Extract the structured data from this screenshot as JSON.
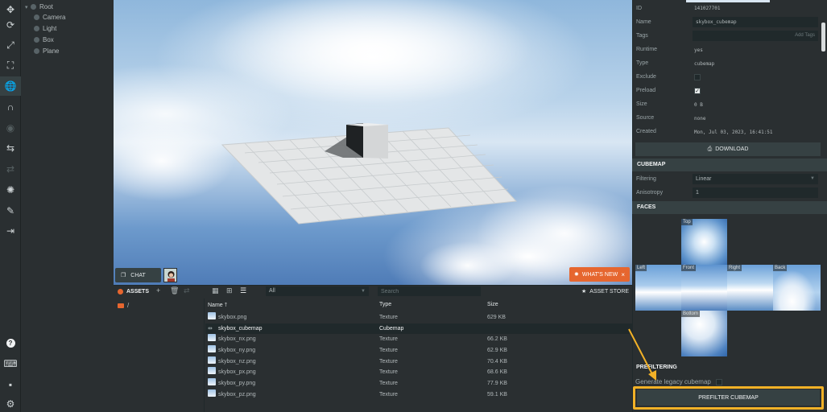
{
  "toolbar": {
    "tools": [
      {
        "name": "translate-icon"
      },
      {
        "name": "rotate-icon"
      },
      {
        "name": "scale-icon"
      },
      {
        "name": "resize-icon"
      },
      {
        "name": "world-icon"
      },
      {
        "name": "magnet-icon"
      },
      {
        "name": "eye-icon"
      },
      {
        "name": "undo-icon"
      },
      {
        "name": "redo-icon"
      },
      {
        "name": "lightbulb-icon"
      },
      {
        "name": "code-editor-icon"
      },
      {
        "name": "launch-icon"
      }
    ],
    "bottom": [
      {
        "name": "help-icon"
      },
      {
        "name": "keyboard-icon"
      },
      {
        "name": "chat-bubble-icon"
      },
      {
        "name": "settings-icon"
      }
    ]
  },
  "hierarchy": {
    "root": "Root",
    "children": [
      "Camera",
      "Light",
      "Box",
      "Plane"
    ]
  },
  "viewport": {
    "chat_label": "CHAT",
    "whats_new_label": "WHAT'S NEW",
    "close_glyph": "×"
  },
  "assets": {
    "title": "ASSETS",
    "filter_selected": "All",
    "search_placeholder": "Search",
    "store_label": "ASSET STORE",
    "root_folder": "/",
    "columns": {
      "name": "Name",
      "type": "Type",
      "size": "Size"
    },
    "rows": [
      {
        "name": "skybox.png",
        "type": "Texture",
        "size": "629 KB"
      },
      {
        "name": "skybox_cubemap",
        "type": "Cubemap",
        "size": ""
      },
      {
        "name": "skybox_nx.png",
        "type": "Texture",
        "size": "66.2 KB"
      },
      {
        "name": "skybox_ny.png",
        "type": "Texture",
        "size": "62.9 KB"
      },
      {
        "name": "skybox_nz.png",
        "type": "Texture",
        "size": "70.4 KB"
      },
      {
        "name": "skybox_px.png",
        "type": "Texture",
        "size": "68.6 KB"
      },
      {
        "name": "skybox_py.png",
        "type": "Texture",
        "size": "77.9 KB"
      },
      {
        "name": "skybox_pz.png",
        "type": "Texture",
        "size": "59.1 KB"
      }
    ]
  },
  "inspector": {
    "props": {
      "id_label": "ID",
      "id_value": "141027701",
      "name_label": "Name",
      "name_value": "skybox_cubemap",
      "tags_label": "Tags",
      "tags_add": "Add Tags",
      "runtime_label": "Runtime",
      "runtime_value": "yes",
      "type_label": "Type",
      "type_value": "cubemap",
      "exclude_label": "Exclude",
      "preload_label": "Preload",
      "size_label": "Size",
      "size_value": "0 B",
      "source_label": "Source",
      "source_value": "none",
      "created_label": "Created",
      "created_value": "Mon, Jul 03, 2023, 16:41:51"
    },
    "download_label": "DOWNLOAD",
    "cubemap_section": "CUBEMAP",
    "filtering_label": "Filtering",
    "filtering_value": "Linear",
    "anisotropy_label": "Anisotropy",
    "anisotropy_value": "1",
    "faces_section": "FACES",
    "faces": {
      "top": "Top",
      "left": "Left",
      "front": "Front",
      "right": "Right",
      "back": "Back",
      "bottom": "Bottom"
    },
    "prefiltering_section": "PREFILTERING",
    "legacy_label": "Generate legacy cubemap",
    "prefilter_button": "PREFILTER CUBEMAP"
  },
  "colors": {
    "accent": "#e6662f",
    "highlight": "#f2b127",
    "panel": "#2a2f31",
    "panel_dark": "#20292b"
  }
}
